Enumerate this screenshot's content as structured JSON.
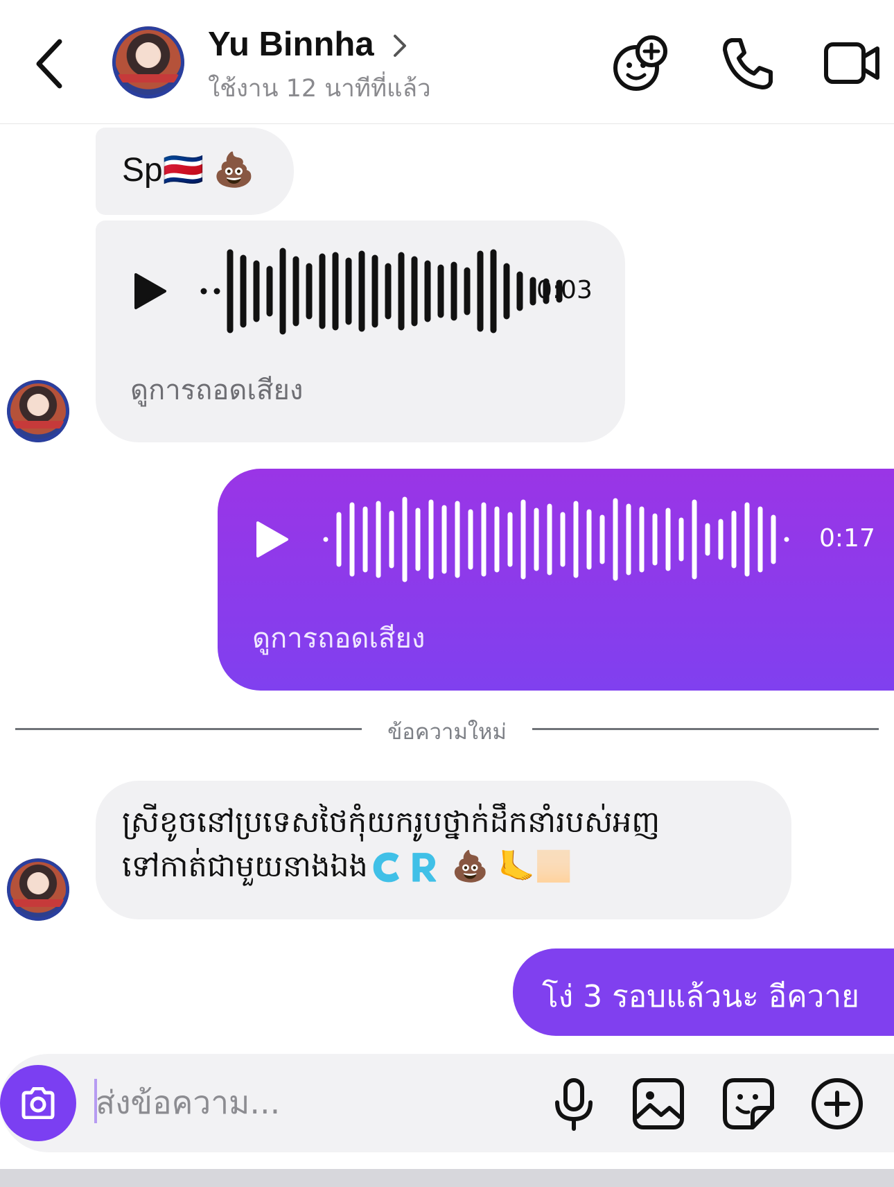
{
  "header": {
    "contact_name": "Yu Binnha",
    "status": "ใช้งาน 12 นาทีที่แล้ว",
    "icons": [
      "back-chevron-icon",
      "chevron-right-icon",
      "effects-face-plus-icon",
      "phone-icon",
      "video-camera-icon"
    ]
  },
  "messages": {
    "m1_text": "Sp🇨🇷 💩",
    "m2_duration": "0:03",
    "m2_transcript": "ดูการถอดเสียง",
    "m3_duration": "0:17",
    "m3_transcript": "ดูการถอดเสียง",
    "divider": "ข้อความใหม่",
    "m4_line1": "ស្រីខូចនៅប្រទេសថៃកុំយករូបថ្នាក់ដឹកនាំរបស់អញ",
    "m4_line2": "ទៅកាត់ជាមួយនាងឯង🇨🇷 💩 🦶🏻",
    "m5_text": "โง่ 3 รอบแล้วนะ อีควาย"
  },
  "composer": {
    "placeholder": "ส่งข้อความ...",
    "icons": [
      "camera-icon",
      "microphone-icon",
      "image-icon",
      "sticker-icon",
      "plus-circle-icon"
    ]
  },
  "colors": {
    "outgoing_bubble": "#8a3cec",
    "incoming_bubble": "#f1f1f3",
    "camera_button": "#7b3ff2",
    "secondary_text": "#8a8a8e"
  }
}
